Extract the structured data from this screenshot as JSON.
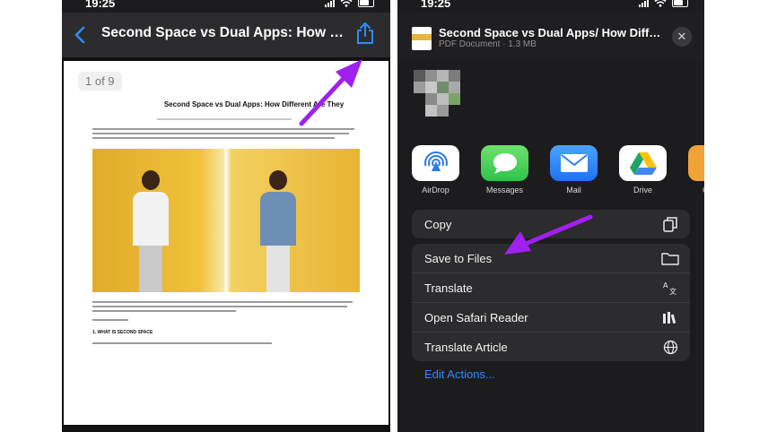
{
  "left": {
    "status_time": "19:25",
    "nav_title": "Second Space vs Dual Apps: How Di...",
    "page_indicator": "1 of 9",
    "doc_heading": "Second Space vs Dual Apps: How Different Are They",
    "doc_subheading": "1. WHAT IS SECOND SPACE"
  },
  "right": {
    "status_time": "19:25",
    "sheet_title": "Second Space vs Dual Apps/ How Differe...",
    "sheet_subtitle": "PDF Document · 1.3 MB",
    "close_glyph": "✕",
    "apps": [
      {
        "label": "AirDrop",
        "icon": "airdrop-icon"
      },
      {
        "label": "Messages",
        "icon": "messages-icon"
      },
      {
        "label": "Mail",
        "icon": "mail-icon"
      },
      {
        "label": "Drive",
        "icon": "google-drive-icon"
      },
      {
        "label": "Copy",
        "icon": "copy-app-icon"
      }
    ],
    "actions_group1": [
      {
        "label": "Copy",
        "icon": "copy-icon"
      }
    ],
    "actions_group2": [
      {
        "label": "Save to Files",
        "icon": "folder-icon"
      },
      {
        "label": "Translate",
        "icon": "translate-icon"
      },
      {
        "label": "Open Safari Reader",
        "icon": "reader-icon"
      },
      {
        "label": "Translate Article",
        "icon": "globe-icon"
      }
    ],
    "edit_actions": "Edit Actions..."
  },
  "colors": {
    "accent_blue": "#2d8bff",
    "annotation_arrow": "#a020f0",
    "sheet_background": "#1c1c1e",
    "row_background": "#2c2c2e"
  }
}
